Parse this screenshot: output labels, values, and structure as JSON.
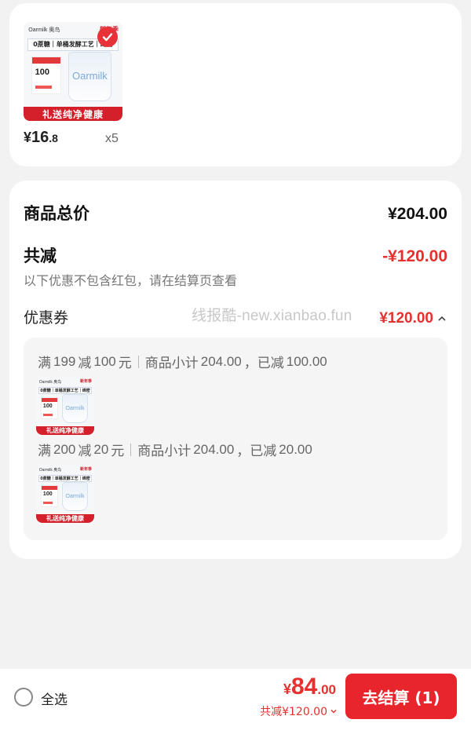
{
  "product": {
    "thumb": {
      "brand": "Oarmilk 奥鸟",
      "brand_right": "新年季",
      "banner": "0蔗糖｜单桶发酵工艺｜绵密",
      "promo_value": "100",
      "cup_text": "Oarmilk",
      "footer": "礼送纯净健康"
    },
    "price": {
      "yen": "¥",
      "int": "16",
      "dec": ".8"
    },
    "quantity": "x5",
    "selected": true
  },
  "summary": {
    "total_label": "商品总价",
    "total_value": "¥204.00",
    "discount_label": "共减",
    "discount_value": "-¥120.00",
    "note": "以下优惠不包含红包，请在结算页查看",
    "coupon_label": "优惠券",
    "coupon_value": "¥120.00",
    "watermark": "线报酷-new.xianbao.fun"
  },
  "coupons": [
    {
      "rule_prefix": "满",
      "threshold": "199",
      "rule_mid": "减",
      "amount": "100",
      "rule_suffix": "元",
      "subtotal_label": "商品小计",
      "subtotal": "204.00",
      "reduced_label": "，已减",
      "reduced": "100.00"
    },
    {
      "rule_prefix": "满",
      "threshold": "200",
      "rule_mid": "减",
      "amount": "20",
      "rule_suffix": "元",
      "subtotal_label": "商品小计",
      "subtotal": "204.00",
      "reduced_label": "，已减",
      "reduced": "20.00"
    }
  ],
  "bottom": {
    "select_all": "全选",
    "pay_yen": "¥",
    "pay_int": "84",
    "pay_dec": ".00",
    "saved": "共减¥120.00",
    "checkout": "去结算 (1)"
  },
  "colors": {
    "accent": "#e8242d",
    "price_red": "#e5312e",
    "background": "#f2f2f2"
  }
}
